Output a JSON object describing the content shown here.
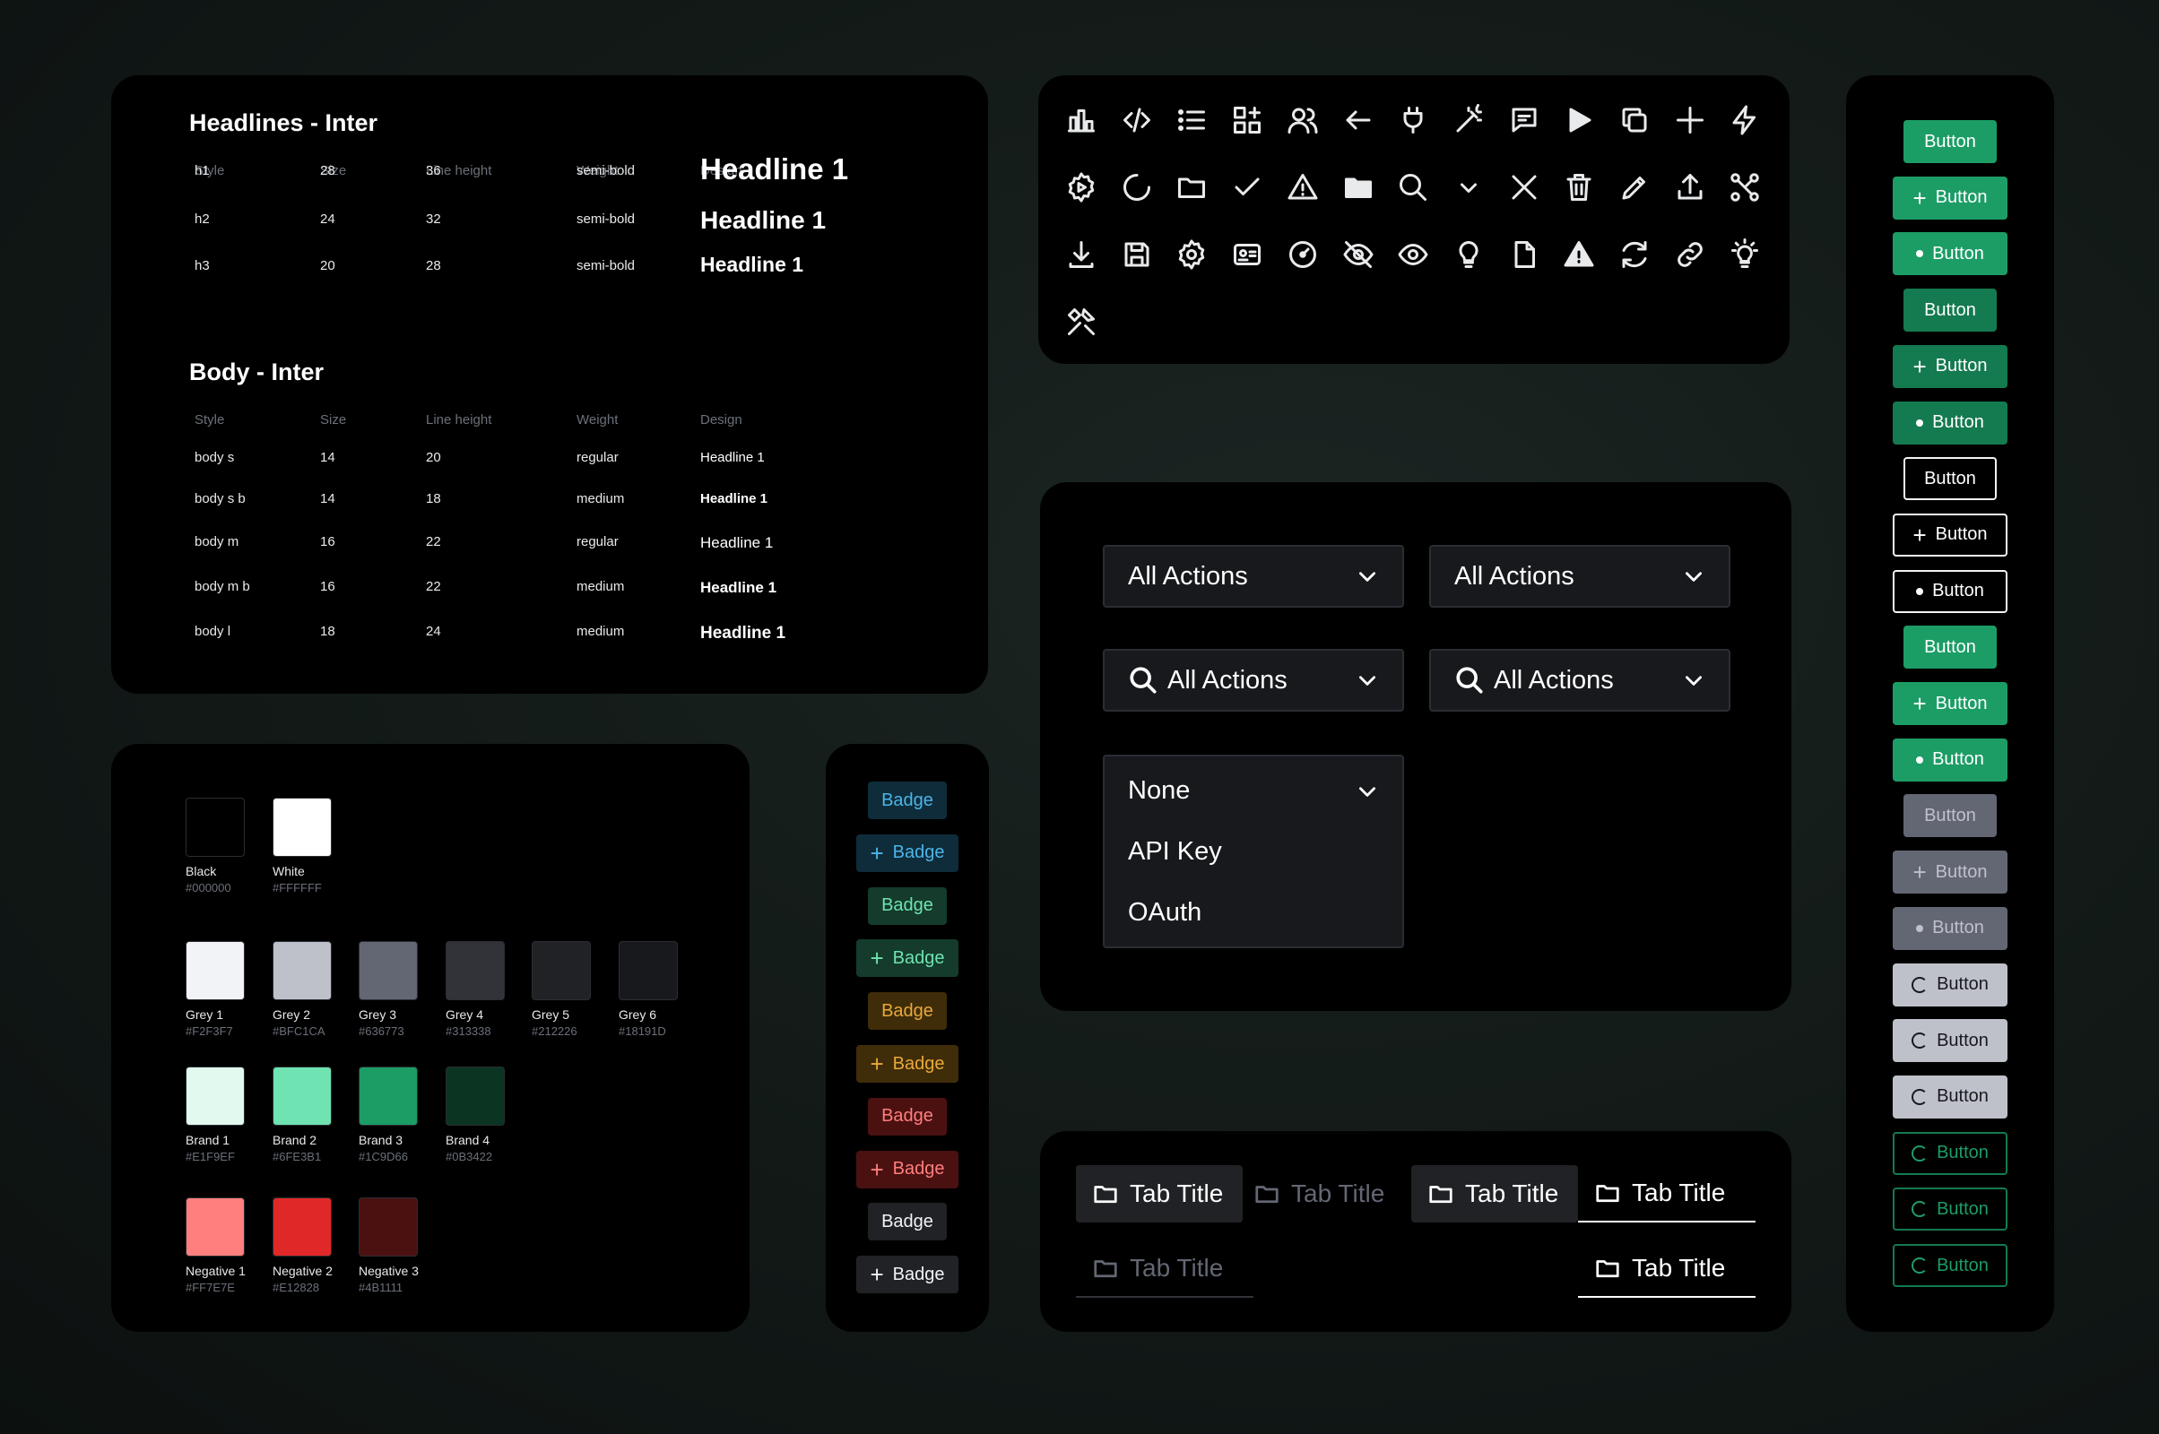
{
  "typography": {
    "headlines_title": "Headlines - Inter",
    "body_title": "Body - Inter",
    "columns": [
      "Style",
      "Size",
      "Line height",
      "Weight",
      "Design"
    ],
    "headlines": [
      {
        "style": "h1",
        "size": "28",
        "line_height": "36",
        "weight": "semi-bold",
        "design": "Headline 1"
      },
      {
        "style": "h2",
        "size": "24",
        "line_height": "32",
        "weight": "semi-bold",
        "design": "Headline 1"
      },
      {
        "style": "h3",
        "size": "20",
        "line_height": "28",
        "weight": "semi-bold",
        "design": "Headline 1"
      }
    ],
    "body": [
      {
        "style": "body s",
        "size": "14",
        "line_height": "20",
        "weight": "regular",
        "design": "Headline 1"
      },
      {
        "style": "body s b",
        "size": "14",
        "line_height": "18",
        "weight": "medium",
        "design": "Headline 1"
      },
      {
        "style": "body m",
        "size": "16",
        "line_height": "22",
        "weight": "regular",
        "design": "Headline 1"
      },
      {
        "style": "body m b",
        "size": "16",
        "line_height": "22",
        "weight": "medium",
        "design": "Headline 1"
      },
      {
        "style": "body l",
        "size": "18",
        "line_height": "24",
        "weight": "medium",
        "design": "Headline 1"
      }
    ]
  },
  "colors": [
    {
      "name": "Black",
      "hex": "#000000"
    },
    {
      "name": "White",
      "hex": "#FFFFFF"
    },
    {
      "name": "Grey 1",
      "hex": "#F2F3F7"
    },
    {
      "name": "Grey 2",
      "hex": "#BFC1CA"
    },
    {
      "name": "Grey 3",
      "hex": "#636773"
    },
    {
      "name": "Grey 4",
      "hex": "#313338"
    },
    {
      "name": "Grey 5",
      "hex": "#212226"
    },
    {
      "name": "Grey 6",
      "hex": "#18191D"
    },
    {
      "name": "Brand 1",
      "hex": "#E1F9EF"
    },
    {
      "name": "Brand 2",
      "hex": "#6FE3B1"
    },
    {
      "name": "Brand 3",
      "hex": "#1C9D66"
    },
    {
      "name": "Brand 4",
      "hex": "#0B3422"
    },
    {
      "name": "Negative 1",
      "hex": "#FF7E7E"
    },
    {
      "name": "Negative 2",
      "hex": "#E12828"
    },
    {
      "name": "Negative 3",
      "hex": "#4B1111"
    }
  ],
  "badges": [
    {
      "label": "Badge",
      "plus": false,
      "bg": "#0e2c3a",
      "fg": "#4cb5e8"
    },
    {
      "label": "Badge",
      "plus": true,
      "bg": "#0e2c3a",
      "fg": "#4cb5e8"
    },
    {
      "label": "Badge",
      "plus": false,
      "bg": "#143b2b",
      "fg": "#6fe3b1"
    },
    {
      "label": "Badge",
      "plus": true,
      "bg": "#143b2b",
      "fg": "#6fe3b1"
    },
    {
      "label": "Badge",
      "plus": false,
      "bg": "#3f2c09",
      "fg": "#e8a93a"
    },
    {
      "label": "Badge",
      "plus": true,
      "bg": "#3f2c09",
      "fg": "#e8a93a"
    },
    {
      "label": "Badge",
      "plus": false,
      "bg": "#4b1111",
      "fg": "#ff7e7e"
    },
    {
      "label": "Badge",
      "plus": true,
      "bg": "#4b1111",
      "fg": "#ff7e7e"
    },
    {
      "label": "Badge",
      "plus": false,
      "bg": "#212226",
      "fg": "#f2f3f7"
    },
    {
      "label": "Badge",
      "plus": true,
      "bg": "#212226",
      "fg": "#f2f3f7"
    }
  ],
  "icons": [
    "bar-chart",
    "code",
    "list",
    "apps-add",
    "users",
    "arrow-left",
    "plug",
    "magic-wand",
    "chat-bubble",
    "play",
    "copy",
    "plus",
    "lightning",
    "settings-play",
    "loader",
    "folder",
    "check",
    "warning",
    "folder-filled",
    "search",
    "chevron-down",
    "close",
    "trash",
    "pencil",
    "upload",
    "workflow",
    "download",
    "save",
    "gear",
    "id-card",
    "gauge",
    "eye-off",
    "eye",
    "bulb",
    "document",
    "warning-filled",
    "refresh",
    "link",
    "bulb-on",
    "tools"
  ],
  "selects": {
    "plain_label": "All Actions",
    "search_label": "All Actions",
    "dropdown_selected": "None",
    "dropdown_options": [
      "API Key",
      "OAuth"
    ]
  },
  "tabs": [
    {
      "label": "Tab Title",
      "state": "filled"
    },
    {
      "label": "Tab Title",
      "state": "disabled"
    },
    {
      "label": "Tab Title",
      "state": "filled"
    },
    {
      "label": "Tab Title",
      "state": "underline"
    },
    {
      "label": "Tab Title",
      "state": "underline-disabled"
    },
    {
      "label": "Tab Title",
      "state": "underline"
    }
  ],
  "buttons": [
    {
      "label": "Button",
      "lead": "none",
      "style": "solid",
      "color": "#1c9d66"
    },
    {
      "label": "Button",
      "lead": "plus",
      "style": "solid",
      "color": "#1c9d66"
    },
    {
      "label": "Button",
      "lead": "dot",
      "style": "solid",
      "color": "#1c9d66"
    },
    {
      "label": "Button",
      "lead": "none",
      "style": "solid",
      "color": "#147a4f"
    },
    {
      "label": "Button",
      "lead": "plus",
      "style": "solid",
      "color": "#147a4f"
    },
    {
      "label": "Button",
      "lead": "dot",
      "style": "solid",
      "color": "#147a4f"
    },
    {
      "label": "Button",
      "lead": "none",
      "style": "outline",
      "color": "#f2f3f7"
    },
    {
      "label": "Button",
      "lead": "plus",
      "style": "outline",
      "color": "#f2f3f7"
    },
    {
      "label": "Button",
      "lead": "dot",
      "style": "outline",
      "color": "#f2f3f7"
    },
    {
      "label": "Button",
      "lead": "none",
      "style": "solid",
      "color": "#1c9d66"
    },
    {
      "label": "Button",
      "lead": "plus",
      "style": "solid",
      "color": "#1c9d66"
    },
    {
      "label": "Button",
      "lead": "dot",
      "style": "solid",
      "color": "#1c9d66"
    },
    {
      "label": "Button",
      "lead": "none",
      "style": "muted",
      "color": "#636773"
    },
    {
      "label": "Button",
      "lead": "plus",
      "style": "muted",
      "color": "#636773"
    },
    {
      "label": "Button",
      "lead": "dot",
      "style": "muted",
      "color": "#636773"
    },
    {
      "label": "Button",
      "lead": "spin",
      "style": "light",
      "color": "#bfc1ca"
    },
    {
      "label": "Button",
      "lead": "spin",
      "style": "light",
      "color": "#bfc1ca"
    },
    {
      "label": "Button",
      "lead": "spin",
      "style": "light",
      "color": "#bfc1ca"
    },
    {
      "label": "Button",
      "lead": "spin",
      "style": "outline-brand",
      "color": "#1c9d66"
    },
    {
      "label": "Button",
      "lead": "spin",
      "style": "outline-brand",
      "color": "#1c9d66"
    },
    {
      "label": "Button",
      "lead": "spin",
      "style": "outline-brand",
      "color": "#1c9d66"
    }
  ]
}
